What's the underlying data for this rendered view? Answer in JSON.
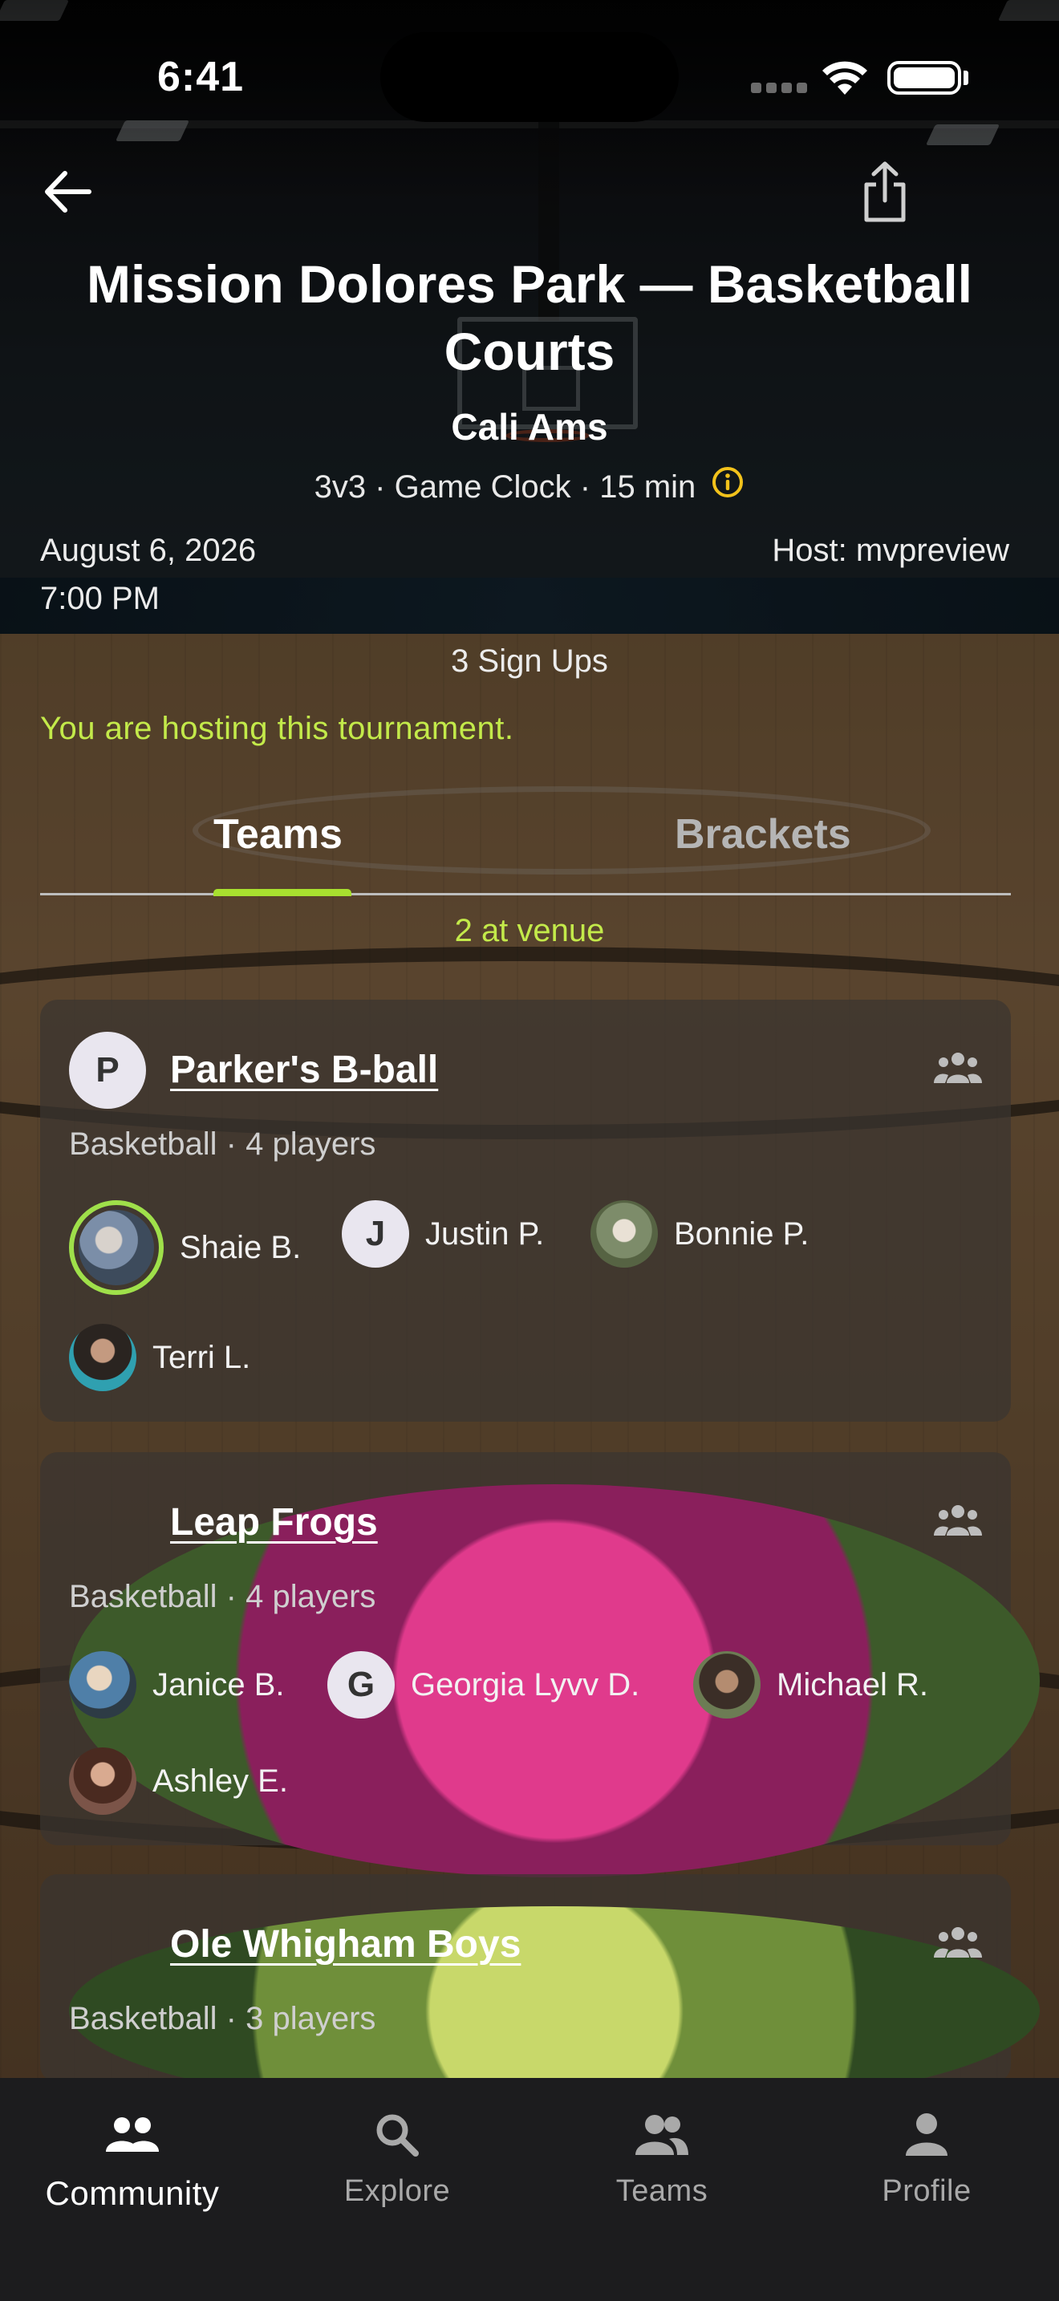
{
  "status_bar": {
    "time": "6:41"
  },
  "header": {
    "title": "Mission Dolores Park — Basketball Courts",
    "subtitle": "Cali Ams",
    "format": "3v3 · Game Clock · 15 min",
    "date": "August 6, 2026",
    "time": "7:00 PM",
    "host": "Host: mvpreview",
    "signups": "3 Sign Ups",
    "hosting_notice": "You are hosting this tournament."
  },
  "tabs": [
    {
      "label": "Teams",
      "active": true
    },
    {
      "label": "Brackets",
      "active": false
    }
  ],
  "venue_count": "2 at venue",
  "teams": [
    {
      "name": "Parker's B-ball",
      "avatar_letter": "P",
      "meta": "Basketball · 4 players",
      "members": [
        {
          "name": "Shaie B.",
          "avatar": "photo",
          "highlighted": true
        },
        {
          "name": "Justin P.",
          "avatar_letter": "J"
        },
        {
          "name": "Bonnie P.",
          "avatar": "photo"
        },
        {
          "name": "Terri L.",
          "avatar": "photo"
        }
      ]
    },
    {
      "name": "Leap Frogs",
      "avatar": "photo",
      "meta": "Basketball · 4 players",
      "members": [
        {
          "name": "Janice B.",
          "avatar": "photo"
        },
        {
          "name": "Georgia Lyvv D.",
          "avatar_letter": "G"
        },
        {
          "name": "Michael R.",
          "avatar": "photo"
        },
        {
          "name": "Ashley E.",
          "avatar": "photo"
        }
      ]
    },
    {
      "name": "Ole Whigham Boys",
      "avatar": "photo",
      "meta": "Basketball · 3 players",
      "members": []
    }
  ],
  "nav": [
    {
      "label": "Community",
      "icon": "community-icon",
      "active": true
    },
    {
      "label": "Explore",
      "icon": "search-icon",
      "active": false
    },
    {
      "label": "Teams",
      "icon": "teams-icon",
      "active": false
    },
    {
      "label": "Profile",
      "icon": "profile-icon",
      "active": false
    }
  ],
  "colors": {
    "accent_green": "#a8e02f",
    "hosting_text": "#c3ea4a",
    "info_icon": "#f2c21b",
    "nav_background": "#1c1c1e"
  }
}
